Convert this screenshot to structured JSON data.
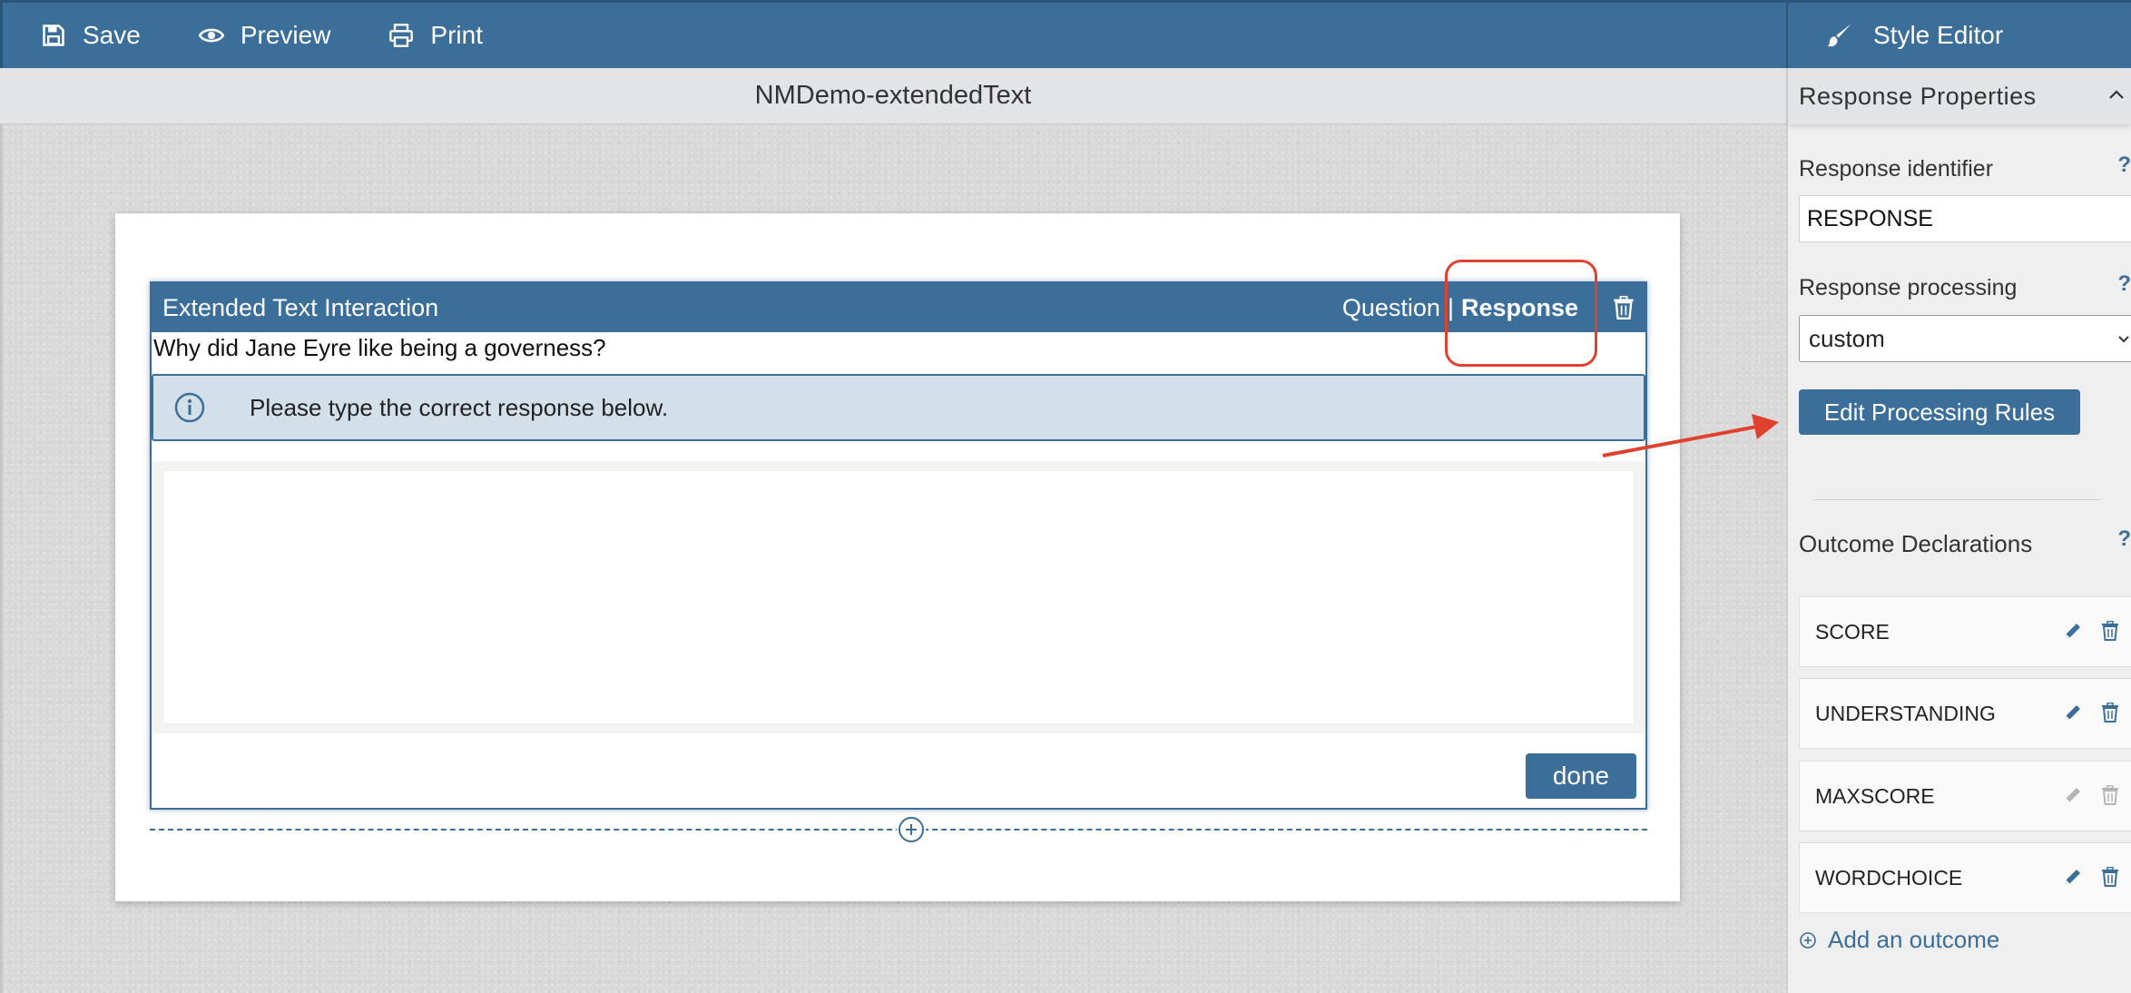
{
  "toolbar": {
    "save_label": "Save",
    "preview_label": "Preview",
    "print_label": "Print"
  },
  "style_editor": {
    "label": "Style Editor"
  },
  "document": {
    "title": "NMDemo-extendedText"
  },
  "interaction": {
    "title": "Extended Text Interaction",
    "tab_question": "Question",
    "tab_separator": "|",
    "tab_response": "Response",
    "active_tab": "Response",
    "prompt": "Why did Jane Eyre like being a governess?",
    "info_message": "Please type the correct response below.",
    "response_text": "",
    "done_label": "done"
  },
  "response_properties": {
    "heading": "Response Properties",
    "identifier_label": "Response identifier",
    "identifier_value": "RESPONSE",
    "processing_label": "Response processing",
    "processing_value": "custom",
    "edit_rules_label": "Edit Processing Rules",
    "help_glyph": "?"
  },
  "outcomes": {
    "heading": "Outcome Declarations",
    "items": [
      {
        "name": "SCORE",
        "editable": true
      },
      {
        "name": "UNDERSTANDING",
        "editable": true
      },
      {
        "name": "MAXSCORE",
        "editable": false
      },
      {
        "name": "WORDCHOICE",
        "editable": true
      }
    ],
    "add_label": "Add an outcome"
  },
  "colors": {
    "brand": "#3b6e99",
    "annotation": "#e0412f",
    "disabled": "#b5b5b5"
  },
  "icons": [
    "save-icon",
    "eye-icon",
    "printer-icon",
    "brush-icon",
    "trash-icon",
    "info-icon",
    "plus-circle-icon",
    "pencil-icon",
    "chevron-up-icon",
    "chevron-down-icon"
  ]
}
